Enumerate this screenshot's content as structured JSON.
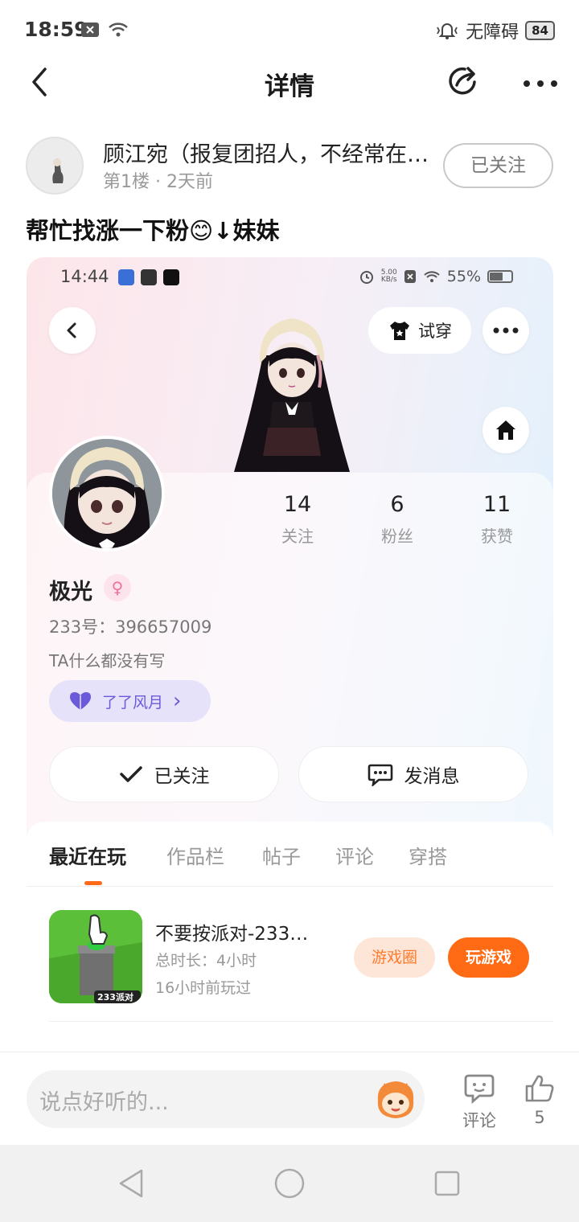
{
  "status_bar": {
    "time": "18:59",
    "accessibility": "无障碍",
    "battery": "84"
  },
  "header": {
    "title": "详情"
  },
  "author": {
    "name": "顾江宛（报复团招人，不经常在…",
    "floor": "第1楼",
    "separator": "·",
    "time_ago": "2天前",
    "follow_label": "已关注"
  },
  "post": {
    "title": "帮忙找涨一下粉😊↓妹妹"
  },
  "screenshot": {
    "status_time": "14:44",
    "net_speed_top": "5.00",
    "net_speed_bottom": "KB/s",
    "battery_percent": "55%",
    "tryon_label": "试穿",
    "stats": [
      {
        "value": "14",
        "label": "关注"
      },
      {
        "value": "6",
        "label": "粉丝"
      },
      {
        "value": "11",
        "label": "获赞"
      }
    ],
    "nickname": "极光",
    "gender_symbol": "♀",
    "uid": "233号：396657009",
    "bio": "TA什么都没有写",
    "tag_label": "了了风月",
    "tag_chevron": "›",
    "followed_label": "已关注",
    "message_label": "发消息",
    "tabs": [
      "最近在玩",
      "作品栏",
      "帖子",
      "评论",
      "穿搭"
    ],
    "game": {
      "title": "不要按派对-233…",
      "playtime": "总时长：4小时",
      "last_played": "16小时前玩过",
      "icon_badge": "233派对",
      "circle_label": "游戏圈",
      "play_label": "玩游戏"
    }
  },
  "bottom_bar": {
    "placeholder": "说点好听的...",
    "comment_label": "评论",
    "like_count": "5"
  },
  "colors": {
    "accent_orange": "#ff6a14",
    "tag_purple": "#6a5ad9",
    "gender_pink": "#f0719b"
  }
}
